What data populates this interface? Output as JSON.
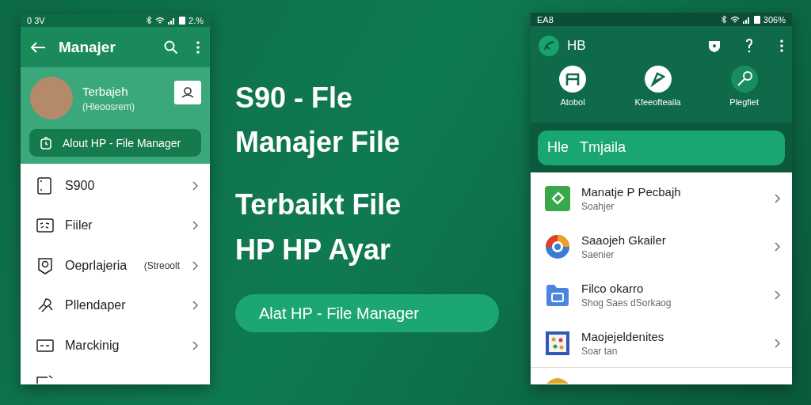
{
  "left_phone": {
    "status_bar": {
      "time": "0 3V",
      "battery": "2.%"
    },
    "app_bar": {
      "title": "Manajer"
    },
    "profile": {
      "name": "Terbajeh",
      "subtitle": "(Hleoosrem)"
    },
    "banner": {
      "label": "Alout HP - File Manager"
    },
    "items": [
      {
        "label": "S900"
      },
      {
        "label": "Fiiler"
      },
      {
        "label": "Oeprlajeria",
        "detail": "(Streoolt"
      },
      {
        "label": "Pllendaper"
      },
      {
        "label": "Marckinig"
      }
    ]
  },
  "headline": {
    "lines": [
      "S90 - Fle",
      "Manajer File"
    ],
    "lines_2": [
      "Terbaikt File",
      "HP HP Ayar"
    ],
    "button": "Alat HP - File Manager"
  },
  "right_phone": {
    "status_bar": {
      "time": "EA8",
      "battery": "306%"
    },
    "app_bar": {
      "title": "HB"
    },
    "shortcuts": [
      {
        "label": "Atobol"
      },
      {
        "label": "Kfeeofteaila"
      },
      {
        "label": "Plegfiet"
      }
    ],
    "banner": {
      "label": "Hle",
      "label_2": "Tmjaila"
    },
    "items": [
      {
        "title": "Manatje P Pecbajh",
        "subtitle": "Soahjer"
      },
      {
        "title": "Saaojeh Gkailer",
        "subtitle": "Saenier"
      },
      {
        "title": "Filco okarro",
        "subtitle": "Shog Saes dSorkaog"
      },
      {
        "title": "Maojejeldenites",
        "subtitle": "Soar tan"
      }
    ]
  }
}
